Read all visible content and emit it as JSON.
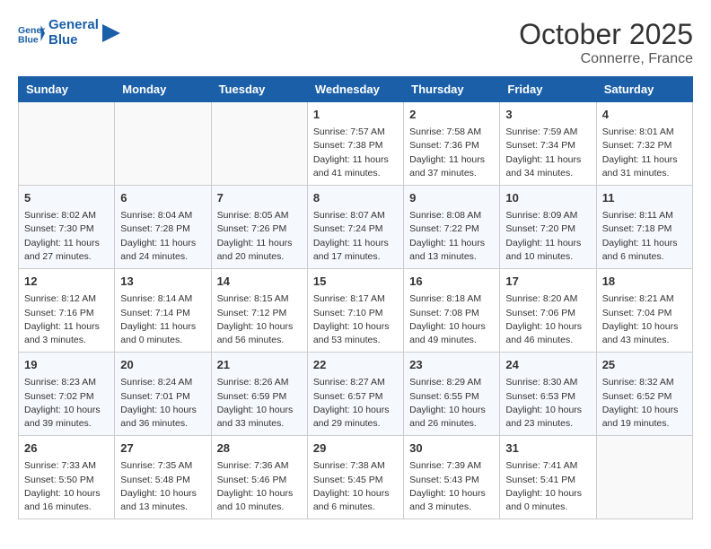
{
  "header": {
    "logo_line1": "General",
    "logo_line2": "Blue",
    "month": "October 2025",
    "location": "Connerre, France"
  },
  "weekdays": [
    "Sunday",
    "Monday",
    "Tuesday",
    "Wednesday",
    "Thursday",
    "Friday",
    "Saturday"
  ],
  "weeks": [
    [
      {
        "day": "",
        "info": ""
      },
      {
        "day": "",
        "info": ""
      },
      {
        "day": "",
        "info": ""
      },
      {
        "day": "1",
        "info": "Sunrise: 7:57 AM\nSunset: 7:38 PM\nDaylight: 11 hours and 41 minutes."
      },
      {
        "day": "2",
        "info": "Sunrise: 7:58 AM\nSunset: 7:36 PM\nDaylight: 11 hours and 37 minutes."
      },
      {
        "day": "3",
        "info": "Sunrise: 7:59 AM\nSunset: 7:34 PM\nDaylight: 11 hours and 34 minutes."
      },
      {
        "day": "4",
        "info": "Sunrise: 8:01 AM\nSunset: 7:32 PM\nDaylight: 11 hours and 31 minutes."
      }
    ],
    [
      {
        "day": "5",
        "info": "Sunrise: 8:02 AM\nSunset: 7:30 PM\nDaylight: 11 hours and 27 minutes."
      },
      {
        "day": "6",
        "info": "Sunrise: 8:04 AM\nSunset: 7:28 PM\nDaylight: 11 hours and 24 minutes."
      },
      {
        "day": "7",
        "info": "Sunrise: 8:05 AM\nSunset: 7:26 PM\nDaylight: 11 hours and 20 minutes."
      },
      {
        "day": "8",
        "info": "Sunrise: 8:07 AM\nSunset: 7:24 PM\nDaylight: 11 hours and 17 minutes."
      },
      {
        "day": "9",
        "info": "Sunrise: 8:08 AM\nSunset: 7:22 PM\nDaylight: 11 hours and 13 minutes."
      },
      {
        "day": "10",
        "info": "Sunrise: 8:09 AM\nSunset: 7:20 PM\nDaylight: 11 hours and 10 minutes."
      },
      {
        "day": "11",
        "info": "Sunrise: 8:11 AM\nSunset: 7:18 PM\nDaylight: 11 hours and 6 minutes."
      }
    ],
    [
      {
        "day": "12",
        "info": "Sunrise: 8:12 AM\nSunset: 7:16 PM\nDaylight: 11 hours and 3 minutes."
      },
      {
        "day": "13",
        "info": "Sunrise: 8:14 AM\nSunset: 7:14 PM\nDaylight: 11 hours and 0 minutes."
      },
      {
        "day": "14",
        "info": "Sunrise: 8:15 AM\nSunset: 7:12 PM\nDaylight: 10 hours and 56 minutes."
      },
      {
        "day": "15",
        "info": "Sunrise: 8:17 AM\nSunset: 7:10 PM\nDaylight: 10 hours and 53 minutes."
      },
      {
        "day": "16",
        "info": "Sunrise: 8:18 AM\nSunset: 7:08 PM\nDaylight: 10 hours and 49 minutes."
      },
      {
        "day": "17",
        "info": "Sunrise: 8:20 AM\nSunset: 7:06 PM\nDaylight: 10 hours and 46 minutes."
      },
      {
        "day": "18",
        "info": "Sunrise: 8:21 AM\nSunset: 7:04 PM\nDaylight: 10 hours and 43 minutes."
      }
    ],
    [
      {
        "day": "19",
        "info": "Sunrise: 8:23 AM\nSunset: 7:02 PM\nDaylight: 10 hours and 39 minutes."
      },
      {
        "day": "20",
        "info": "Sunrise: 8:24 AM\nSunset: 7:01 PM\nDaylight: 10 hours and 36 minutes."
      },
      {
        "day": "21",
        "info": "Sunrise: 8:26 AM\nSunset: 6:59 PM\nDaylight: 10 hours and 33 minutes."
      },
      {
        "day": "22",
        "info": "Sunrise: 8:27 AM\nSunset: 6:57 PM\nDaylight: 10 hours and 29 minutes."
      },
      {
        "day": "23",
        "info": "Sunrise: 8:29 AM\nSunset: 6:55 PM\nDaylight: 10 hours and 26 minutes."
      },
      {
        "day": "24",
        "info": "Sunrise: 8:30 AM\nSunset: 6:53 PM\nDaylight: 10 hours and 23 minutes."
      },
      {
        "day": "25",
        "info": "Sunrise: 8:32 AM\nSunset: 6:52 PM\nDaylight: 10 hours and 19 minutes."
      }
    ],
    [
      {
        "day": "26",
        "info": "Sunrise: 7:33 AM\nSunset: 5:50 PM\nDaylight: 10 hours and 16 minutes."
      },
      {
        "day": "27",
        "info": "Sunrise: 7:35 AM\nSunset: 5:48 PM\nDaylight: 10 hours and 13 minutes."
      },
      {
        "day": "28",
        "info": "Sunrise: 7:36 AM\nSunset: 5:46 PM\nDaylight: 10 hours and 10 minutes."
      },
      {
        "day": "29",
        "info": "Sunrise: 7:38 AM\nSunset: 5:45 PM\nDaylight: 10 hours and 6 minutes."
      },
      {
        "day": "30",
        "info": "Sunrise: 7:39 AM\nSunset: 5:43 PM\nDaylight: 10 hours and 3 minutes."
      },
      {
        "day": "31",
        "info": "Sunrise: 7:41 AM\nSunset: 5:41 PM\nDaylight: 10 hours and 0 minutes."
      },
      {
        "day": "",
        "info": ""
      }
    ]
  ]
}
